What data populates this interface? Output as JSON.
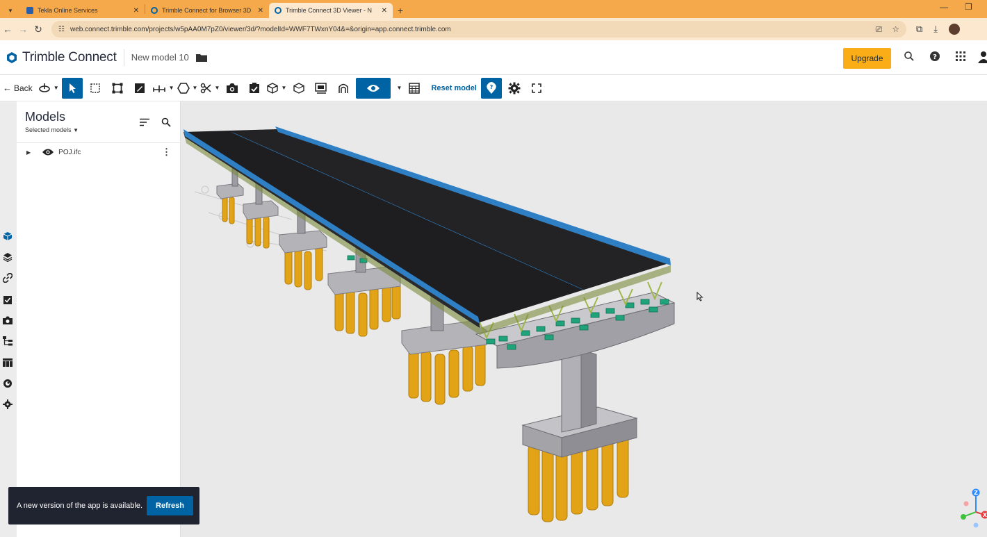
{
  "browser": {
    "tabs": [
      {
        "title": "Tekla Online Services",
        "active": false
      },
      {
        "title": "Trimble Connect for Browser 3D",
        "active": false
      },
      {
        "title": "Trimble Connect 3D Viewer - N",
        "active": true
      }
    ],
    "url": "web.connect.trimble.com/projects/w5pAA0M7pZ0/viewer/3d/?modelId=WWF7TWxnY04&=&origin=app.connect.trimble.com"
  },
  "header": {
    "brand": "Trimble Connect",
    "project_name": "New model 10",
    "upgrade_label": "Upgrade"
  },
  "toolbar": {
    "back_label": "Back",
    "reset_label": "Reset model"
  },
  "panel": {
    "title": "Models",
    "subtitle": "Selected models",
    "models": [
      {
        "name": "POJ.ifc"
      }
    ]
  },
  "toast": {
    "message": "A new version of the app is available.",
    "button_label": "Refresh"
  },
  "colors": {
    "accent": "#0063a3",
    "upgrade": "#fbad17",
    "chrome_tab_bar": "#f6a94a",
    "deck": "#1e1e20",
    "girder_blue": "#2f7fc4",
    "piles": "#e3a317",
    "concrete": "#a9a9ae"
  },
  "axis_gizmo": {
    "z_label": "Z",
    "x_label": "X"
  }
}
